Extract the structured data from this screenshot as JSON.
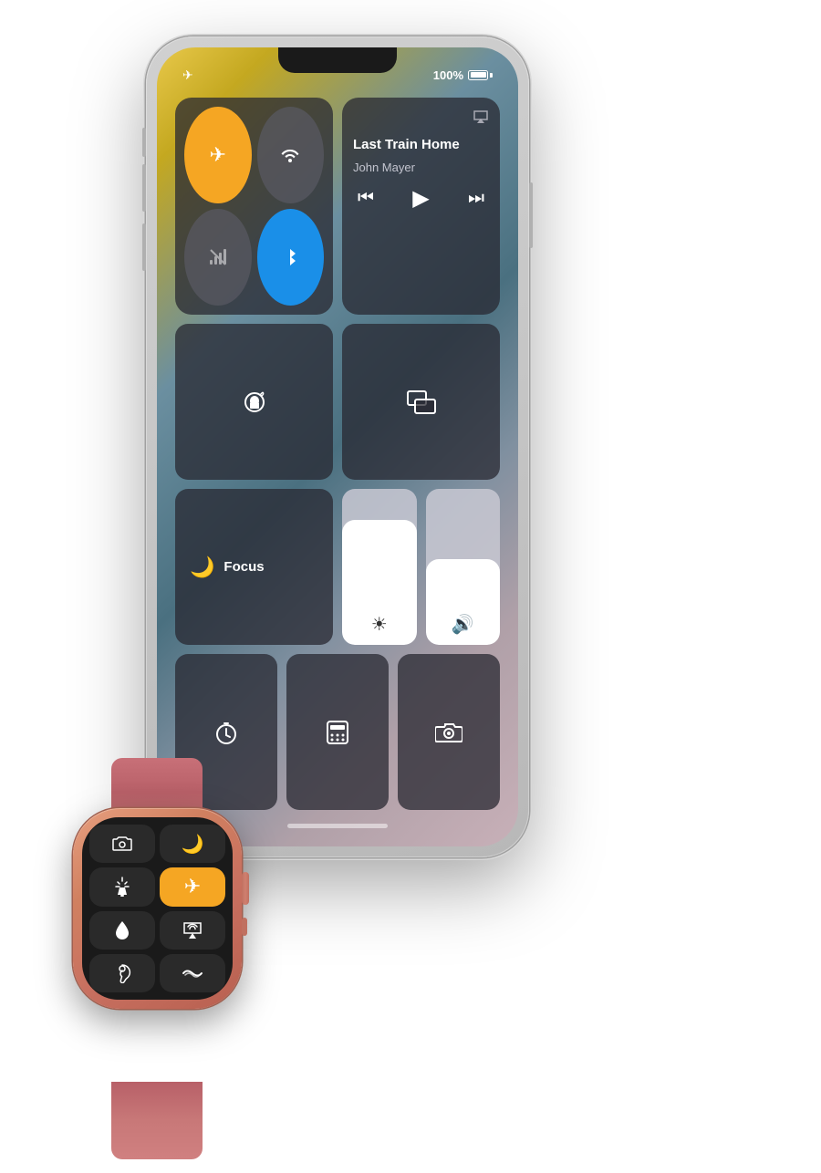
{
  "scene": {
    "background": "white"
  },
  "iphone": {
    "status": {
      "battery": "100%",
      "airplane_mode": true
    },
    "control_center": {
      "connectivity": {
        "airplane": {
          "active": true,
          "label": "Airplane Mode"
        },
        "wifi": {
          "active": false,
          "label": "Wi-Fi"
        },
        "cellular": {
          "active": false,
          "label": "Cellular"
        },
        "bluetooth": {
          "active": true,
          "label": "Bluetooth"
        }
      },
      "now_playing": {
        "title": "Last Train Home",
        "artist": "John Mayer",
        "airplay_icon": "📡"
      },
      "orientation_lock": {
        "label": "Orientation Lock"
      },
      "screen_mirror": {
        "label": "Screen Mirror"
      },
      "focus": {
        "icon": "🌙",
        "label": "Focus"
      },
      "brightness": {
        "level": 80,
        "icon": "☀"
      },
      "volume": {
        "level": 55,
        "icon": "🔊"
      },
      "bottom_row": {
        "timer": {
          "label": "Timer",
          "icon": "⏱"
        },
        "calculator": {
          "label": "Calculator",
          "icon": "⌨"
        },
        "camera": {
          "label": "Camera",
          "icon": "📷"
        }
      }
    }
  },
  "apple_watch": {
    "buttons": [
      {
        "icon": "📷",
        "label": "Camera",
        "active": false
      },
      {
        "icon": "🌙",
        "label": "Sleep",
        "active": false
      },
      {
        "icon": "🔦",
        "label": "Flashlight",
        "active": false
      },
      {
        "icon": "✈",
        "label": "Airplane Mode",
        "active": true
      },
      {
        "icon": "💧",
        "label": "Water Lock",
        "active": false
      },
      {
        "icon": "📡",
        "label": "AirPlay",
        "active": false
      },
      {
        "icon": "👂",
        "label": "Hearing",
        "active": false
      },
      {
        "icon": "〜",
        "label": "Walkie Talkie",
        "active": false
      }
    ]
  }
}
